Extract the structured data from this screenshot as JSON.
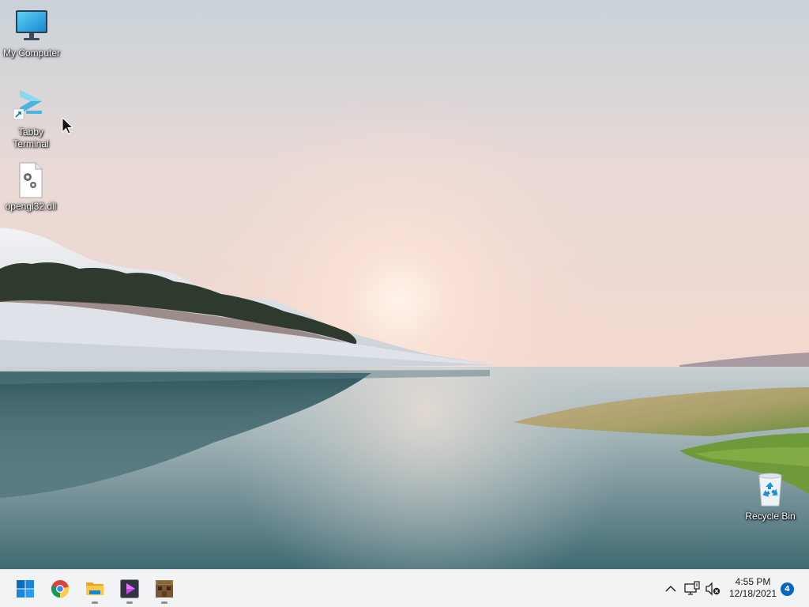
{
  "desktop": {
    "icons": [
      {
        "label": "My Computer",
        "icon": "monitor-icon"
      },
      {
        "label": "Tabby\nTerminal",
        "icon": "tabby-terminal-icon"
      },
      {
        "label": "opengl32.dll",
        "icon": "dll-file-icon"
      },
      {
        "label": "Recycle Bin",
        "icon": "recycle-bin-icon"
      }
    ]
  },
  "taskbar": {
    "apps": [
      {
        "name": "Start",
        "icon": "windows-start-icon",
        "running": false
      },
      {
        "name": "Google Chrome",
        "icon": "chrome-icon",
        "running": false
      },
      {
        "name": "File Explorer",
        "icon": "folder-icon",
        "running": true
      },
      {
        "name": "Tabby Terminal",
        "icon": "tabby-terminal-icon",
        "running": true
      },
      {
        "name": "Minecraft",
        "icon": "crafting-table-icon",
        "running": true
      }
    ],
    "tray": {
      "icons": [
        "chevron-up-icon",
        "network-icon",
        "volume-muted-icon"
      ],
      "time": "4:55 PM",
      "date": "12/18/2021",
      "notification_count": "4"
    }
  },
  "colors": {
    "accent": "#0067c0",
    "taskbar_bg": "#f1f3f5",
    "sky_top": "#c9d3da",
    "sky_glow": "#f6dcd3"
  }
}
